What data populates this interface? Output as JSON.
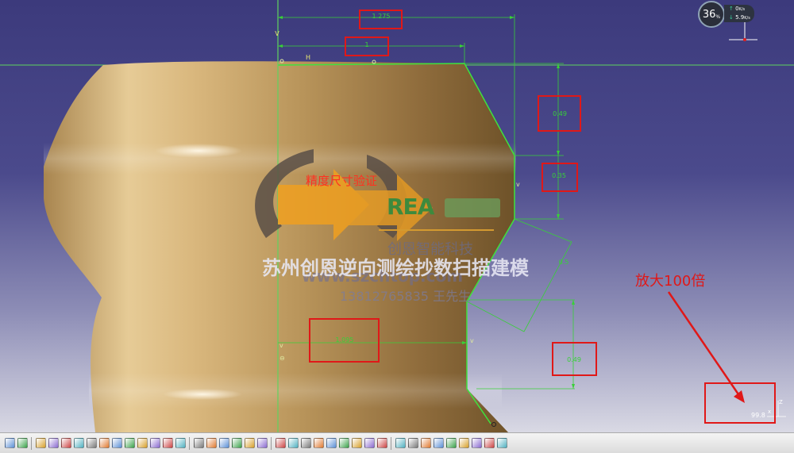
{
  "dimensions": {
    "top_width": "1.275",
    "inner_width": "1",
    "height_upper": "0.49",
    "height_mid": "0.35",
    "chamfer": "0.5",
    "lower_width": "1.095",
    "lower_height": "0.49"
  },
  "sketch_labels": {
    "v_axis": "V",
    "h_axis": "H"
  },
  "watermark": {
    "accuracy_label": "精度尺寸验证",
    "brand_logo": "REA",
    "company_cn": "创恩智能科技",
    "website": "www.szchtop.com",
    "banner": "苏州创恩逆向测绘抄数扫描建模",
    "phone": "13812765835 王先生"
  },
  "annotation": {
    "zoom_note": "放大100倍",
    "scale_value": "99.8"
  },
  "compass": {
    "value": "36",
    "unit": "%"
  },
  "perf_widget": {
    "upload": "0",
    "upload_unit": "K/s",
    "download": "5.9",
    "download_unit": "K/s"
  },
  "axis_indicator": {
    "z_label": "Z",
    "x_label": "x"
  },
  "colors": {
    "sketch_green": "#38d038",
    "annotation_red": "#e01818",
    "part_tan": "#c9a56d",
    "background_top": "#3c3a7c"
  },
  "toolbar_icons": [
    "select-icon",
    "help-icon",
    "sketcher-icon",
    "fit-all-icon",
    "pan-icon",
    "rotate-icon",
    "zoom-in-icon",
    "zoom-out-icon",
    "normal-view-icon",
    "iso-view-icon",
    "view-mode-icon",
    "hide-show-icon",
    "swap-space-icon",
    "render-icon",
    "constraint-icon",
    "contact-icon",
    "fix-icon",
    "edit-constraint-icon",
    "auto-constraint-icon",
    "animate-icon",
    "profile-icon",
    "line-icon",
    "point-icon",
    "circle-icon",
    "spline-icon",
    "corner-icon",
    "chamfer-icon",
    "trim-icon",
    "mirror-icon",
    "grid-icon",
    "snap-icon",
    "construction-icon",
    "geometry-icon",
    "dimension-icon",
    "analysis-icon",
    "exit-sketch-icon",
    "update-icon",
    "measure-icon"
  ]
}
